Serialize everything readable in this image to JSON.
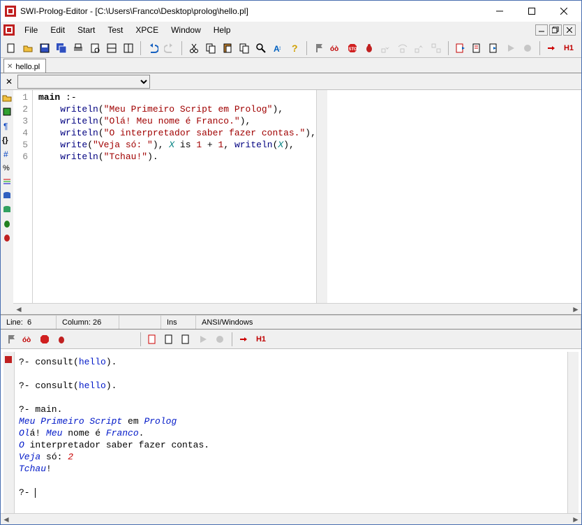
{
  "window": {
    "title": "SWI-Prolog-Editor - [C:\\Users\\Franco\\Desktop\\prolog\\hello.pl]"
  },
  "menu": {
    "file": "File",
    "edit": "Edit",
    "start": "Start",
    "test": "Test",
    "xpce": "XPCE",
    "window": "Window",
    "help": "Help"
  },
  "tab": {
    "name": "hello.pl"
  },
  "editor": {
    "lines": [
      {
        "n": "1",
        "raw": "main :-"
      },
      {
        "n": "2",
        "raw": "    writeln(\"Meu Primeiro Script em Prolog\"),"
      },
      {
        "n": "3",
        "raw": "    writeln(\"Olá! Meu nome é Franco.\"),"
      },
      {
        "n": "4",
        "raw": "    writeln(\"O interpretador saber fazer contas.\"),"
      },
      {
        "n": "5",
        "raw": "    write(\"Veja só: \"), X is 1 + 1, writeln(X),"
      },
      {
        "n": "6",
        "raw": "    writeln(\"Tchau!\")."
      }
    ]
  },
  "status": {
    "line_label": "Line:",
    "line_val": "6",
    "col_label": "Column:",
    "col_val": "26",
    "ins": "Ins",
    "encoding": "ANSI/Windows"
  },
  "console": {
    "q1": "?- consult(hello).",
    "q2": "?- consult(hello).",
    "q3": "?- main.",
    "out1_a": "Meu Primeiro Script",
    "out1_b": " em ",
    "out1_c": "Prolog",
    "out2_a": "Ol",
    "out2_b": "á! ",
    "out2_c": "Meu",
    "out2_d": " nome é ",
    "out2_e": "Franco",
    "out2_f": ".",
    "out3_a": "O",
    "out3_b": " interpretador saber fazer contas.",
    "out4_a": "Veja",
    "out4_b": " só: ",
    "out4_c": "2",
    "out5_a": "Tchau",
    "out5_b": "!",
    "prompt": "?- "
  },
  "icons": {
    "toolbar1": [
      "new",
      "open",
      "save",
      "saveall",
      "print",
      "preview",
      "split-h",
      "split-v",
      "sep",
      "undo",
      "redo",
      "sep",
      "cut",
      "copy",
      "paste",
      "copy2",
      "find",
      "font",
      "help"
    ],
    "toolbar_debug": [
      "flag",
      "trace",
      "stop",
      "bug",
      "step-into",
      "step-over",
      "step-out",
      "run-to",
      "sep",
      "goto1",
      "goto2",
      "goto3",
      "play",
      "record",
      "sep",
      "to-h",
      "h1"
    ],
    "h1_text": "H1"
  }
}
